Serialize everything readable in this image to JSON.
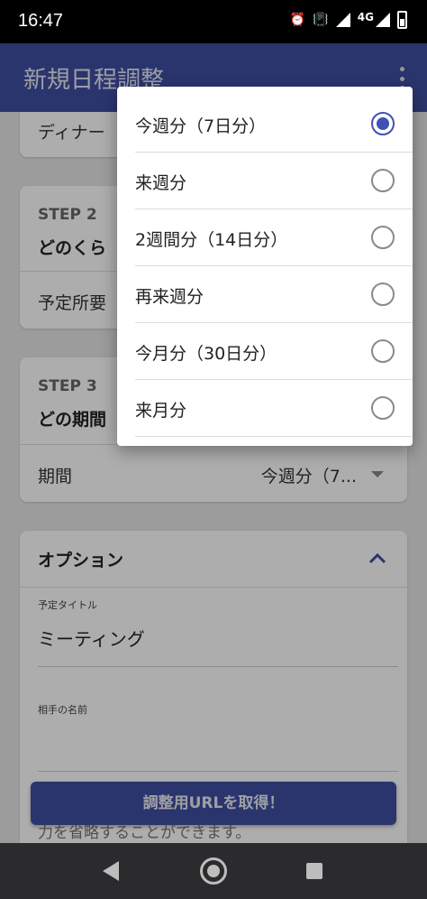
{
  "status_bar": {
    "time": "16:47",
    "network": "4G",
    "icons": [
      "alarm-icon",
      "vibrate-icon",
      "signal-icon",
      "network-4g-icon",
      "battery-icon"
    ]
  },
  "app_bar": {
    "title": "新規日程調整",
    "menu_icon": "more-vert-icon"
  },
  "step1": {
    "row_label": "ディナー"
  },
  "step2": {
    "step_label": "STEP 2",
    "title": "どのくら",
    "row_label": "予定所要"
  },
  "step3": {
    "step_label": "STEP 3",
    "title": "どの期間",
    "row_label": "期間",
    "selected_value": "今週分（7..."
  },
  "options_card": {
    "title": "オプション",
    "fields": [
      {
        "label": "予定タイトル",
        "value": "ミーティング"
      },
      {
        "label": "相手の名前",
        "value": ""
      }
    ],
    "helper_text": "力を省略することができます。"
  },
  "cta": {
    "label": "調整用URLを取得！"
  },
  "period_dropdown": {
    "options": [
      {
        "label": "今週分（7日分）",
        "selected": true
      },
      {
        "label": "来週分",
        "selected": false
      },
      {
        "label": "2週間分（14日分）",
        "selected": false
      },
      {
        "label": "再来週分",
        "selected": false
      },
      {
        "label": "今月分（30日分）",
        "selected": false
      },
      {
        "label": "来月分",
        "selected": false
      }
    ]
  },
  "colors": {
    "primary": "#3e4fa3",
    "radio_selected": "#4051b5",
    "nav_bar": "#2b2b2d"
  }
}
